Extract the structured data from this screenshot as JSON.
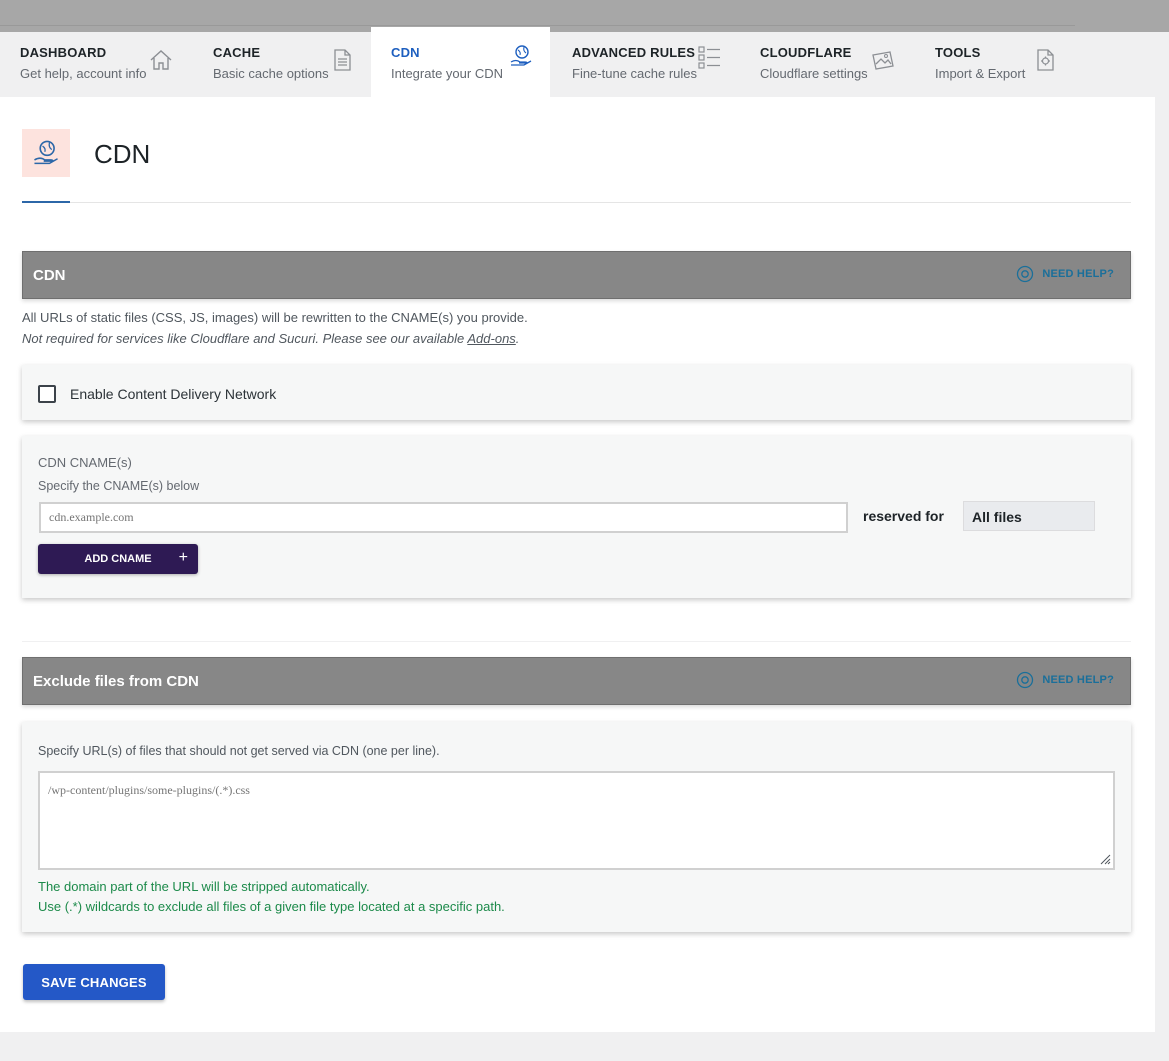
{
  "tabs": [
    {
      "title": "DASHBOARD",
      "subtitle": "Get help, account info",
      "icon": "home-icon"
    },
    {
      "title": "CACHE",
      "subtitle": "Basic cache options",
      "icon": "document-icon"
    },
    {
      "title": "CDN",
      "subtitle": "Integrate your CDN",
      "icon": "globe-hand-icon"
    },
    {
      "title": "ADVANCED RULES",
      "subtitle": "Fine-tune cache rules",
      "icon": "checklist-icon"
    },
    {
      "title": "CLOUDFLARE",
      "subtitle": "Cloudflare settings",
      "icon": "cloudflare-icon"
    },
    {
      "title": "TOOLS",
      "subtitle": "Import & Export",
      "icon": "gear-document-icon"
    }
  ],
  "active_tab": "CDN",
  "page": {
    "title": "CDN"
  },
  "cdn_section": {
    "title": "CDN",
    "need_help": "NEED HELP?",
    "desc_line1": "All URLs of static files (CSS, JS, images) will be rewritten to the CNAME(s) you provide.",
    "desc_line2": "Not required for services like Cloudflare and Sucuri. Please see our available",
    "desc_link": "Add-ons",
    "desc_end": ".",
    "enable_label": "Enable Content Delivery Network",
    "enable_checked": false
  },
  "cname": {
    "label": "CDN CNAME(s)",
    "hint": "Specify the CNAME(s) below",
    "placeholder": "cdn.example.com",
    "reserved_label": "reserved for",
    "reserved_value": "All files",
    "add_button": "ADD CNAME",
    "add_plus": "+"
  },
  "exclude_section": {
    "title": "Exclude files from CDN",
    "need_help": "NEED HELP?",
    "label": "Specify URL(s) of files that should not get served via CDN (one per line).",
    "placeholder": "/wp-content/plugins/some-plugins/(.*).css",
    "help1": "The domain part of the URL will be stripped automatically.",
    "help2": "Use (.*) wildcards to exclude all files of a given file type located at a specific path."
  },
  "save_button": "SAVE CHANGES",
  "colors": {
    "accent": "#1e5fbf",
    "save": "#2458c7",
    "add": "#2e1a54",
    "help_green": "#1c8a4a",
    "section_bar": "#878787"
  }
}
